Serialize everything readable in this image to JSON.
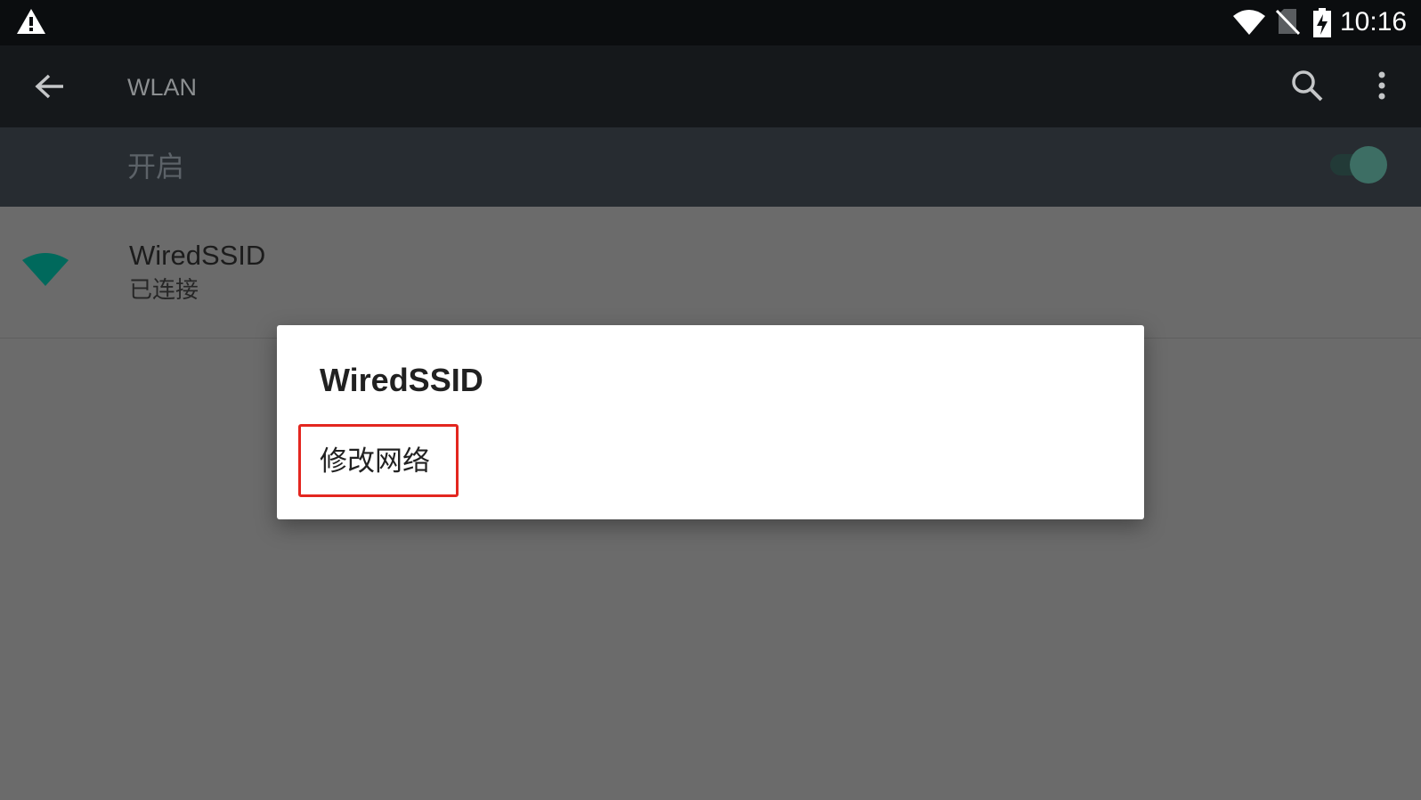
{
  "status_bar": {
    "time": "10:16",
    "icons": [
      "warning-icon",
      "wifi-signal-icon",
      "no-sim-icon",
      "battery-charging-icon"
    ]
  },
  "app_bar": {
    "title": "WLAN",
    "icons": [
      "back-arrow-icon",
      "search-icon",
      "more-vert-icon"
    ]
  },
  "wifi_switch": {
    "label": "开启",
    "state": "on",
    "accent_color": "#3d6e64"
  },
  "networks": [
    {
      "ssid": "WiredSSID",
      "status": "已连接",
      "signal_color": "#00695c"
    }
  ],
  "dialog": {
    "title": "WiredSSID",
    "options": [
      "修改网络"
    ],
    "highlight_color": "#e3261f"
  }
}
